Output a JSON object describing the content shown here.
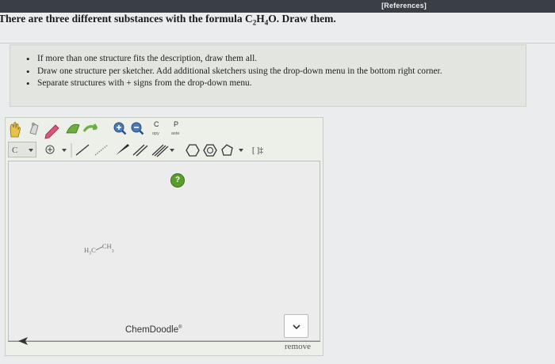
{
  "header": {
    "references_label": "[References]"
  },
  "question": {
    "prefix": "There are three different substances with the formula C",
    "c_sub": "2",
    "h": "H",
    "h_sub": "4",
    "suffix": "O. Draw them."
  },
  "instructions": [
    "If more than one structure fits the description, draw them all.",
    "Draw one structure per sketcher. Add additional sketchers using the drop-down menu in the bottom right corner.",
    "Separate structures with + signs from the drop-down menu."
  ],
  "toolbar": {
    "copy_letter": "C",
    "copy_label": "opy",
    "paste_letter": "P",
    "paste_label": "aste",
    "element_label": "C",
    "charge_label": "[ ]‡"
  },
  "sketcher": {
    "help_label": "?",
    "molecule": {
      "left": "H",
      "left_sub": "3",
      "mid": "C",
      "right": "CH",
      "right_sub": "3"
    },
    "brand": "ChemDoodle",
    "brand_mark": "®",
    "remove_label": "remove"
  },
  "colors": {
    "topbar": "#3a3f45",
    "help_green": "#5c9b2e",
    "pencil_pink": "#d9557d",
    "eraser_green": "#6cae3f"
  }
}
